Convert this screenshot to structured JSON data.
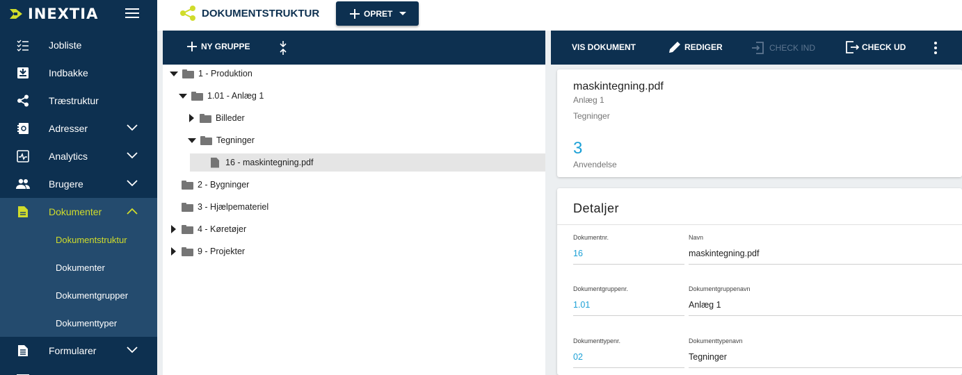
{
  "brand": {
    "name": "INEXTIA",
    "accent": "#d0dc2b",
    "navy": "#0d3050"
  },
  "sidebar": {
    "items": [
      {
        "label": "Jobliste",
        "icon": "checklist-icon"
      },
      {
        "label": "Indbakke",
        "icon": "inbox-icon"
      },
      {
        "label": "Træstruktur",
        "icon": "share-tree-icon"
      },
      {
        "label": "Adresser",
        "icon": "address-book-icon",
        "expandable": true
      },
      {
        "label": "Analytics",
        "icon": "analytics-icon",
        "expandable": true
      },
      {
        "label": "Brugere",
        "icon": "users-icon",
        "expandable": true
      },
      {
        "label": "Dokumenter",
        "icon": "document-icon",
        "expandable": true,
        "active": true
      },
      {
        "label": "Formularer",
        "icon": "form-icon",
        "expandable": true
      }
    ],
    "sub_items": [
      "Dokumentstruktur",
      "Dokumenter",
      "Dokumentgrupper",
      "Dokumenttyper"
    ]
  },
  "topbar": {
    "title": "DOKUMENTSTRUKTUR",
    "create_label": "OPRET"
  },
  "tree": {
    "new_group_label": "NY GRUPPE",
    "nodes": [
      {
        "label": "1 - Produktion",
        "level": 0,
        "state": "expanded",
        "type": "folder"
      },
      {
        "label": "1.01 - Anlæg 1",
        "level": 1,
        "state": "expanded",
        "type": "folder"
      },
      {
        "label": "Billeder",
        "level": 2,
        "state": "collapsed",
        "type": "folder"
      },
      {
        "label": "Tegninger",
        "level": 2,
        "state": "expanded",
        "type": "folder"
      },
      {
        "label": "16 - maskintegning.pdf",
        "level": 3,
        "state": "leaf",
        "type": "file",
        "selected": true
      },
      {
        "label": "2 - Bygninger",
        "level": 0,
        "state": "leaf",
        "type": "folder"
      },
      {
        "label": "3 - Hjælpemateriel",
        "level": 0,
        "state": "leaf",
        "type": "folder"
      },
      {
        "label": "4 - Køretøjer",
        "level": 0,
        "state": "collapsed",
        "type": "folder"
      },
      {
        "label": "9 - Projekter",
        "level": 0,
        "state": "collapsed",
        "type": "folder"
      }
    ]
  },
  "doc_toolbar": {
    "view_label": "VIS DOKUMENT",
    "edit_label": "REDIGER",
    "checkin_label": "CHECK IND",
    "checkout_label": "CHECK UD"
  },
  "summary": {
    "filename": "maskintegning.pdf",
    "group": "Anlæg 1",
    "type": "Tegninger",
    "usage_count": "3",
    "usage_label": "Anvendelse"
  },
  "details": {
    "title": "Detaljer",
    "fields": [
      {
        "label": "Dokumentnr.",
        "value": "16",
        "link": true
      },
      {
        "label": "Navn",
        "value": "maskintegning.pdf",
        "link": false
      },
      {
        "label": "Dokumentgruppenr.",
        "value": "1.01",
        "link": true
      },
      {
        "label": "Dokumentgruppenavn",
        "value": "Anlæg 1",
        "link": false
      },
      {
        "label": "Dokumenttypenr.",
        "value": "02",
        "link": true
      },
      {
        "label": "Dokumenttypenavn",
        "value": "Tegninger",
        "link": false
      }
    ]
  }
}
